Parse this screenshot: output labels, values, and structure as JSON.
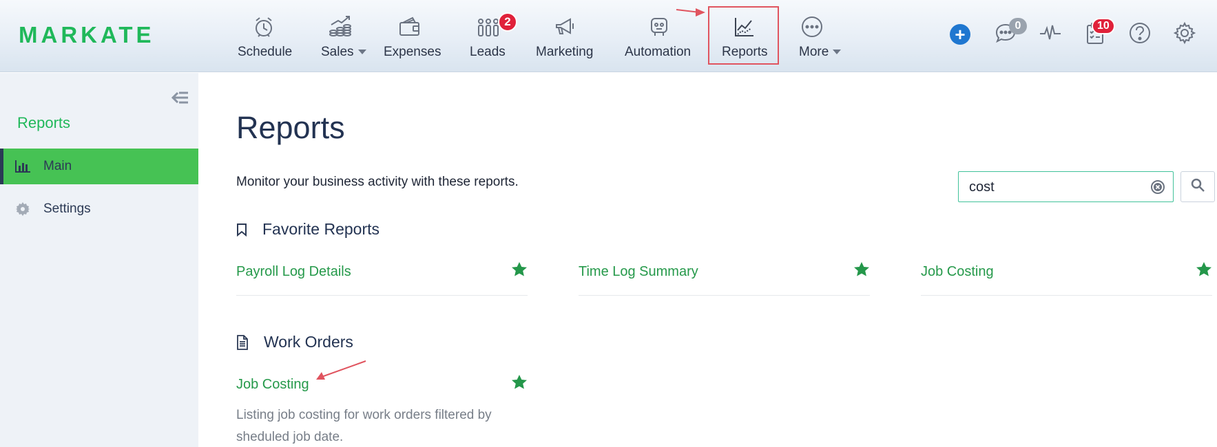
{
  "app": {
    "logo_text": "MARKATE",
    "brand_color": "#20b85a"
  },
  "nav": {
    "items": [
      {
        "label": "Schedule",
        "icon": "alarm-clock-icon"
      },
      {
        "label": "Sales",
        "icon": "growth-chart-icon",
        "has_dropdown": true
      },
      {
        "label": "Expenses",
        "icon": "wallet-icon"
      },
      {
        "label": "Leads",
        "icon": "people-icon",
        "badge": "2"
      },
      {
        "label": "Marketing",
        "icon": "megaphone-icon"
      },
      {
        "label": "Automation",
        "icon": "robot-icon"
      },
      {
        "label": "Reports",
        "icon": "line-chart-icon",
        "highlighted": true
      },
      {
        "label": "More",
        "icon": "more-dots-icon",
        "has_dropdown": true
      }
    ],
    "right_icons": [
      {
        "name": "add-icon"
      },
      {
        "name": "chat-icon",
        "badge": "0"
      },
      {
        "name": "activity-pulse-icon"
      },
      {
        "name": "tasks-clipboard-icon",
        "badge": "10"
      },
      {
        "name": "help-icon"
      },
      {
        "name": "gear-icon"
      }
    ]
  },
  "sidebar": {
    "title": "Reports",
    "items": [
      {
        "label": "Main",
        "icon": "bar-chart-icon",
        "active": true
      },
      {
        "label": "Settings",
        "icon": "gear-icon",
        "active": false
      }
    ]
  },
  "main": {
    "title": "Reports",
    "description": "Monitor your business activity with these reports.",
    "search": {
      "value": "cost",
      "placeholder": ""
    },
    "sections": [
      {
        "title": "Favorite Reports",
        "icon": "bookmark-icon",
        "reports": [
          {
            "name": "Payroll Log Details",
            "favorite": true
          },
          {
            "name": "Time Log Summary",
            "favorite": true
          },
          {
            "name": "Job Costing",
            "favorite": true
          }
        ]
      },
      {
        "title": "Work Orders",
        "icon": "document-icon",
        "reports": [
          {
            "name": "Job Costing",
            "favorite": true,
            "description": "Listing job costing for work orders filtered by sheduled job date."
          }
        ]
      }
    ]
  },
  "colors": {
    "link_green": "#25994a",
    "active_green": "#46c254",
    "badge_red": "#e0213a",
    "annotation_red": "#e0545f"
  }
}
